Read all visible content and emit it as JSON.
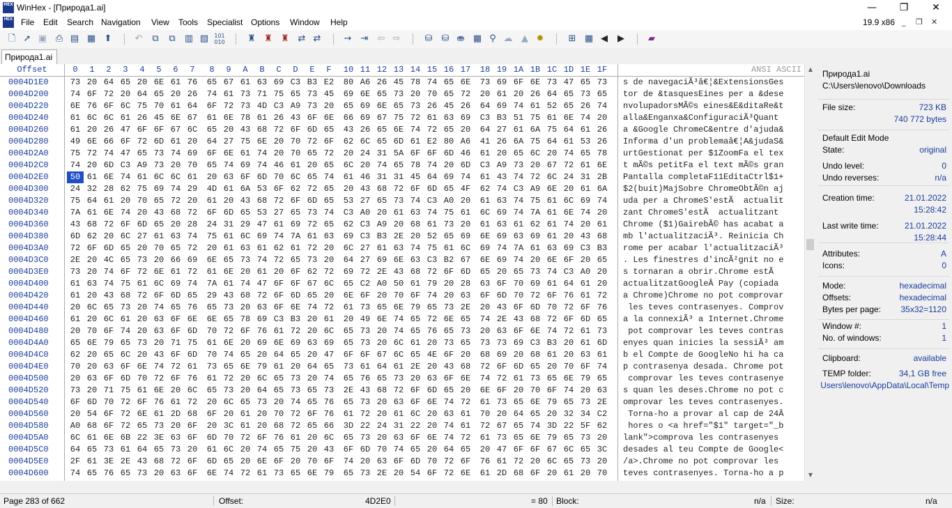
{
  "window": {
    "title": "WinHex - [Природа1.ai]",
    "app_icon": "HEX",
    "min": "—",
    "max": "❐",
    "close": "✕"
  },
  "menu": {
    "items": [
      "File",
      "Edit",
      "Search",
      "Navigation",
      "View",
      "Tools",
      "Specialist",
      "Options",
      "Window",
      "Help"
    ],
    "zoom": "19.9 x86",
    "mdi_min": "_",
    "mdi_restore": "❐",
    "mdi_close": "✕"
  },
  "tab": {
    "label": "Природа1.ai"
  },
  "editor": {
    "offset_header": "Offset",
    "ascii_header": "ANSI ASCII",
    "col_headers": [
      "0",
      "1",
      "2",
      "3",
      "4",
      "5",
      "6",
      "7",
      "8",
      "9",
      "A",
      "B",
      "C",
      "D",
      "E",
      "F",
      "10",
      "11",
      "12",
      "13",
      "14",
      "15",
      "16",
      "17",
      "18",
      "19",
      "1A",
      "1B",
      "1C",
      "1D",
      "1E",
      "1F"
    ],
    "rows": [
      {
        "offset": "0004D1E0",
        "hex": "73 20 64 65 20 6E 61 76 65 67 61 63 69 C3 B3 E2 80 A6 26 45 78 74 65 6E 73 69 6F 6E 73 47 65 73",
        "ascii": "s de navegaciÃ³â€¦&ExtensionsGes"
      },
      {
        "offset": "0004D200",
        "hex": "74 6F 72 20 64 65 20 26 74 61 73 71 75 65 73 45 69 6E 65 73 20 70 65 72 20 61 20 26 64 65 73 65",
        "ascii": "tor de &tasquesEines per a &dese"
      },
      {
        "offset": "0004D220",
        "hex": "6E 76 6F 6C 75 70 61 64 6F 72 73 4D C3 A9 73 20 65 69 6E 65 73 26 45 26 64 69 74 61 52 65 26 74",
        "ascii": "nvolupadorsMÃ©s eines&E&ditaRe&t"
      },
      {
        "offset": "0004D240",
        "hex": "61 6C 6C 61 26 45 6E 67 61 6E 78 61 26 43 6F 6E 66 69 67 75 72 61 63 69 C3 B3 51 75 61 6E 74 20",
        "ascii": "alla&Enganxa&ConfiguraciÃ³Quant "
      },
      {
        "offset": "0004D260",
        "hex": "61 20 26 47 6F 6F 67 6C 65 20 43 68 72 6F 6D 65 43 26 65 6E 74 72 65 20 64 27 61 6A 75 64 61 26",
        "ascii": "a &Google ChromeC&entre d'ajuda&"
      },
      {
        "offset": "0004D280",
        "hex": "49 6E 66 6F 72 6D 61 20 64 27 75 6E 20 70 72 6F 62 6C 65 6D 61 E2 80 A6 41 26 6A 75 64 61 53 26",
        "ascii": "Informa d'un problemaâ€¦A&judaS&"
      },
      {
        "offset": "0004D2A0",
        "hex": "75 72 74 47 65 73 74 69 6F 6E 61 74 20 70 65 72 20 24 31 5A 6F 6F 6D 46 61 20 65 6C 20 74 65 78",
        "ascii": "urtGestionat per $1ZoomFa el tex"
      },
      {
        "offset": "0004D2C0",
        "hex": "74 20 6D C3 A9 73 20 70 65 74 69 74 46 61 20 65 6C 20 74 65 78 74 20 6D C3 A9 73 20 67 72 61 6E",
        "ascii": "t mÃ©s petitFa el text mÃ©s gran"
      },
      {
        "offset": "0004D2E0",
        "hex": "50 61 6E 74 61 6C 6C 61 20 63 6F 6D 70 6C 65 74 61 46 31 31 45 64 69 74 61 43 74 72 6C 24 31 2B",
        "ascii": "Pantalla completaF11EditaCtrl$1+"
      },
      {
        "offset": "0004D300",
        "hex": "24 32 28 62 75 69 74 29 4D 61 6A 53 6F 62 72 65 20 43 68 72 6F 6D 65 4F 62 74 C3 A9 6E 20 61 6A",
        "ascii": "$2(buit)MajSobre ChromeObtÃ©n aj"
      },
      {
        "offset": "0004D320",
        "hex": "75 64 61 20 70 65 72 20 61 20 43 68 72 6F 6D 65 53 27 65 73 74 C3 A0 20 61 63 74 75 61 6C 69 74",
        "ascii": "uda per a ChromeS'estÃ  actualit"
      },
      {
        "offset": "0004D340",
        "hex": "7A 61 6E 74 20 43 68 72 6F 6D 65 53 27 65 73 74 C3 A0 20 61 63 74 75 61 6C 69 74 7A 61 6E 74 20",
        "ascii": "zant ChromeS'estÃ  actualitzant "
      },
      {
        "offset": "0004D360",
        "hex": "43 68 72 6F 6D 65 20 28 24 31 29 47 61 69 72 65 62 C3 A9 20 68 61 73 20 61 63 61 62 61 74 20 61",
        "ascii": "Chrome ($1)GairebÃ© has acabat a"
      },
      {
        "offset": "0004D380",
        "hex": "6D 62 20 6C 27 61 63 74 75 61 6C 69 74 7A 61 63 69 C3 B3 2E 20 52 65 69 6E 69 63 69 61 20 43 68",
        "ascii": "mb l'actualitzaciÃ³. Reinicia Ch"
      },
      {
        "offset": "0004D3A0",
        "hex": "72 6F 6D 65 20 70 65 72 20 61 63 61 62 61 72 20 6C 27 61 63 74 75 61 6C 69 74 7A 61 63 69 C3 B3",
        "ascii": "rome per acabar l'actualitzaciÃ³"
      },
      {
        "offset": "0004D3C0",
        "hex": "2E 20 4C 65 73 20 66 69 6E 65 73 74 72 65 73 20 64 27 69 6E 63 C3 B2 67 6E 69 74 20 6E 6F 20 65",
        "ascii": ". Les finestres d'incÃ²gnit no e"
      },
      {
        "offset": "0004D3E0",
        "hex": "73 20 74 6F 72 6E 61 72 61 6E 20 61 20 6F 62 72 69 72 2E 43 68 72 6F 6D 65 20 65 73 74 C3 A0 20",
        "ascii": "s tornaran a obrir.Chrome estÃ  "
      },
      {
        "offset": "0004D400",
        "hex": "61 63 74 75 61 6C 69 74 7A 61 74 47 6F 6F 67 6C 65 C2 A0 50 61 79 20 28 63 6F 70 69 61 64 61 20",
        "ascii": "actualitzatGoogleÂ Pay (copiada "
      },
      {
        "offset": "0004D420",
        "hex": "61 20 43 68 72 6F 6D 65 29 43 68 72 6F 6D 65 20 6E 6F 20 70 6F 74 20 63 6F 6D 70 72 6F 76 61 72",
        "ascii": "a Chrome)Chrome no pot comprovar"
      },
      {
        "offset": "0004D440",
        "hex": "20 6C 65 73 20 74 65 76 65 73 20 63 6F 6E 74 72 61 73 65 6E 79 65 73 2E 20 43 6F 6D 70 72 6F 76",
        "ascii": " les teves contrasenyes. Comprov"
      },
      {
        "offset": "0004D460",
        "hex": "61 20 6C 61 20 63 6F 6E 6E 65 78 69 C3 B3 20 61 20 49 6E 74 65 72 6E 65 74 2E 43 68 72 6F 6D 65",
        "ascii": "a la connexiÃ³ a Internet.Chrome"
      },
      {
        "offset": "0004D480",
        "hex": "20 70 6F 74 20 63 6F 6D 70 72 6F 76 61 72 20 6C 65 73 20 74 65 76 65 73 20 63 6F 6E 74 72 61 73",
        "ascii": " pot comprovar les teves contras"
      },
      {
        "offset": "0004D4A0",
        "hex": "65 6E 79 65 73 20 71 75 61 6E 20 69 6E 69 63 69 65 73 20 6C 61 20 73 65 73 73 69 C3 B3 20 61 6D",
        "ascii": "enyes quan inicies la sessiÃ³ am"
      },
      {
        "offset": "0004D4C0",
        "hex": "62 20 65 6C 20 43 6F 6D 70 74 65 20 64 65 20 47 6F 6F 67 6C 65 4E 6F 20 68 69 20 68 61 20 63 61",
        "ascii": "b el Compte de GoogleNo hi ha ca"
      },
      {
        "offset": "0004D4E0",
        "hex": "70 20 63 6F 6E 74 72 61 73 65 6E 79 61 20 64 65 73 61 64 61 2E 20 43 68 72 6F 6D 65 20 70 6F 74",
        "ascii": "p contrasenya desada. Chrome pot"
      },
      {
        "offset": "0004D500",
        "hex": "20 63 6F 6D 70 72 6F 76 61 72 20 6C 65 73 20 74 65 76 65 73 20 63 6F 6E 74 72 61 73 65 6E 79 65",
        "ascii": " comprovar les teves contrasenye"
      },
      {
        "offset": "0004D520",
        "hex": "73 20 71 75 61 6E 20 6C 65 73 20 64 65 73 65 73 2E 43 68 72 6F 6D 65 20 6E 6F 20 70 6F 74 20 63",
        "ascii": "s quan les deses.Chrome no pot c"
      },
      {
        "offset": "0004D540",
        "hex": "6F 6D 70 72 6F 76 61 72 20 6C 65 73 20 74 65 76 65 73 20 63 6F 6E 74 72 61 73 65 6E 79 65 73 2E",
        "ascii": "omprovar les teves contrasenyes."
      },
      {
        "offset": "0004D560",
        "hex": "20 54 6F 72 6E 61 2D 68 6F 20 61 20 70 72 6F 76 61 72 20 61 6C 20 63 61 70 20 64 65 20 32 34 C2",
        "ascii": " Torna-ho a provar al cap de 24Â"
      },
      {
        "offset": "0004D580",
        "hex": "A0 68 6F 72 65 73 20 6F 20 3C 61 20 68 72 65 66 3D 22 24 31 22 20 74 61 72 67 65 74 3D 22 5F 62",
        "ascii": " hores o <a href=\"$1\" target=\"_b"
      },
      {
        "offset": "0004D5A0",
        "hex": "6C 61 6E 6B 22 3E 63 6F 6D 70 72 6F 76 61 20 6C 65 73 20 63 6F 6E 74 72 61 73 65 6E 79 65 73 20",
        "ascii": "lank\">comprova les contrasenyes "
      },
      {
        "offset": "0004D5C0",
        "hex": "64 65 73 61 64 65 73 20 61 6C 20 74 65 75 20 43 6F 6D 70 74 65 20 64 65 20 47 6F 6F 67 6C 65 3C",
        "ascii": "desades al teu Compte de Google<"
      },
      {
        "offset": "0004D5E0",
        "hex": "2F 61 3E 2E 43 68 72 6F 6D 65 20 6E 6F 20 70 6F 74 20 63 6F 6D 70 72 6F 76 61 72 20 6C 65 73 20",
        "ascii": "/a>.Chrome no pot comprovar les "
      },
      {
        "offset": "0004D600",
        "hex": "74 65 76 65 73 20 63 6F 6E 74 72 61 73 65 6E 79 65 73 2E 20 54 6F 72 6E 61 2D 68 6F 20 61 20 70",
        "ascii": "teves contrasenyes. Torna-ho a p"
      }
    ]
  },
  "info": {
    "file_name": "Природа1.ai",
    "file_path": "C:\\Users\\lenovo\\Downloads",
    "file_size_label": "File size:",
    "file_size_kb": "723 KB",
    "file_size_bytes": "740 772 bytes",
    "edit_mode_title": "Default Edit Mode",
    "state_label": "State:",
    "state_value": "original",
    "undo_level_label": "Undo level:",
    "undo_level_value": "0",
    "undo_reverses_label": "Undo reverses:",
    "undo_reverses_value": "n/a",
    "creation_label": "Creation time:",
    "creation_date": "21.01.2022",
    "creation_time": "15:28:42",
    "lastwrite_label": "Last write time:",
    "lastwrite_date": "21.01.2022",
    "lastwrite_time": "15:28:44",
    "attributes_label": "Attributes:",
    "attributes_value": "A",
    "icons_label": "Icons:",
    "icons_value": "0",
    "mode_label": "Mode:",
    "mode_value": "hexadecimal",
    "offsets_label": "Offsets:",
    "offsets_value": "hexadecimal",
    "bpp_label": "Bytes per page:",
    "bpp_value": "35x32=1120",
    "window_no_label": "Window #:",
    "window_no_value": "1",
    "windows_count_label": "No. of windows:",
    "windows_count_value": "1",
    "clipboard_label": "Clipboard:",
    "clipboard_value": "available",
    "temp_label": "TEMP folder:",
    "temp_value": "34,1 GB free",
    "temp_path": "Users\\lenovo\\AppData\\Local\\Temp"
  },
  "status": {
    "page": "Page 283 of 662",
    "offset_label": "Offset:",
    "offset_value": "4D2E0",
    "eq_value": "= 80",
    "block_label": "Block:",
    "block_value": "n/a",
    "size_label": "Size:",
    "size_value": "n/a"
  },
  "toolbar_icons": [
    "new-file-icon",
    "open-file-icon",
    "save-icon",
    "print-icon",
    "properties-icon",
    "open-disk-icon",
    "export-icon",
    "undo-icon",
    "copy-icon",
    "cut-icon",
    "paste-icon",
    "paste-special-icon",
    "binary-icon",
    "find-icon",
    "find-hex-icon",
    "find-replace-icon",
    "replace-hex-icon",
    "goto-offset-icon",
    "goto-sector-icon",
    "back-icon",
    "forward-icon",
    "open-drive-icon",
    "disk-tools-icon",
    "ram-icon",
    "calculator-icon",
    "search-icon",
    "hash-icon",
    "analyze-icon",
    "options-icon",
    "columns-icon",
    "table-icon",
    "prev-icon",
    "next-icon",
    "book-icon"
  ]
}
